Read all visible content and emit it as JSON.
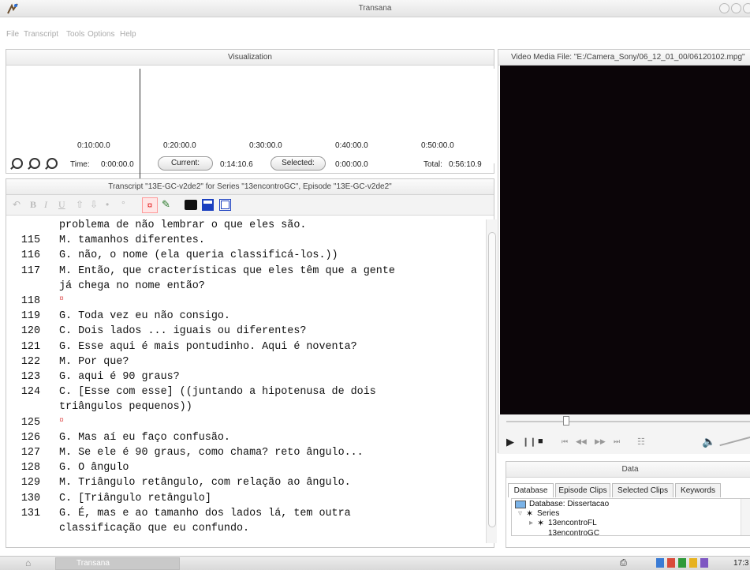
{
  "window": {
    "title": "Transana"
  },
  "menu": {
    "items": [
      "File",
      "Transcript",
      "Tools",
      "Options",
      "Help"
    ]
  },
  "visualization": {
    "header": "Visualization",
    "timeline_labels": [
      "0:10:00.0",
      "0:20:00.0",
      "0:30:00.0",
      "0:40:00.0",
      "0:50:00.0"
    ],
    "time_label": "Time:",
    "time_value": "0:00:00.0",
    "current_label": "Current:",
    "current_value": "0:14:10.6",
    "selected_label": "Selected:",
    "selected_value": "0:00:00.0",
    "total_label": "Total:",
    "total_value": "0:56:10.9"
  },
  "transcript": {
    "header": "Transcript \"13E-GC-v2de2\" for Series \"13encontroGC\", Episode \"13E-GC-v2de2\"",
    "lines": [
      {
        "num": "",
        "text": "problema de não lembrar o que eles são."
      },
      {
        "num": "115",
        "text": "M. tamanhos diferentes."
      },
      {
        "num": "116",
        "text": "G. não, o nome (ela queria classificá-los.))"
      },
      {
        "num": "117",
        "text": "M. Então, que cracterísticas que eles têm que a gente"
      },
      {
        "num": "",
        "text": "já chega no nome então?"
      },
      {
        "num": "118",
        "text": "¤"
      },
      {
        "num": "119",
        "text": "G. Toda vez eu não consigo."
      },
      {
        "num": "120",
        "text": "C. Dois lados ... iguais ou diferentes?"
      },
      {
        "num": "121",
        "text": "G. Esse aqui é mais pontudinho. Aqui é noventa?"
      },
      {
        "num": "122",
        "text": "M. Por que?"
      },
      {
        "num": "123",
        "text": "G. aqui é 90 graus?"
      },
      {
        "num": "124",
        "text": "C. [Esse com esse] ((juntando a hipotenusa de dois"
      },
      {
        "num": "",
        "text": "triângulos pequenos))"
      },
      {
        "num": "125",
        "text": "¤"
      },
      {
        "num": "126",
        "text": "G. Mas aí eu faço confusão."
      },
      {
        "num": "127",
        "text": "M. Se ele é 90 graus, como chama? reto ângulo..."
      },
      {
        "num": "128",
        "text": "G. O ângulo"
      },
      {
        "num": "129",
        "text": "M. Triângulo retângulo, com relação ao ângulo."
      },
      {
        "num": "130",
        "text": "C. [Triângulo retângulo]"
      },
      {
        "num": "131",
        "text": "G. É, mas e ao tamanho dos lados lá, tem outra"
      },
      {
        "num": "",
        "text": "classificação que eu confundo."
      }
    ]
  },
  "video": {
    "header": "Video Media File: \"E:/Camera_Sony/06_12_01_00/06120102.mpg\""
  },
  "data": {
    "header": "Data",
    "tabs": [
      "Database",
      "Episode Clips",
      "Selected Clips",
      "Keywords"
    ],
    "tree": {
      "database": "Database: Dissertacao",
      "series": "Series",
      "item1": "13encontroFL",
      "item2": "13encontroGC"
    }
  },
  "taskbar": {
    "app_label": "Transana",
    "clock": "17:3"
  },
  "colors": {
    "video_bg": "#0b0508",
    "accent_red": "#e02020",
    "accent_blue": "#1a3fbf"
  }
}
